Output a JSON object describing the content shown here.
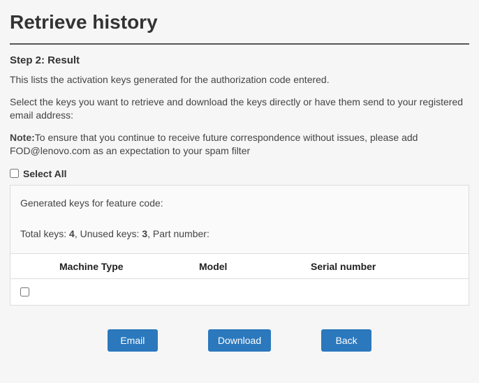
{
  "page": {
    "title": "Retrieve history",
    "step_title": "Step 2: Result",
    "desc1": "This lists the activation keys generated for the authorization code entered.",
    "desc2": "Select the keys you want to retrieve and download the keys directly or have them send to your registered email address:",
    "note_label": "Note:",
    "note_text": "To ensure that you continue to receive future correspondence without issues, please add FOD@lenovo.com as an expectation to your spam filter"
  },
  "select_all_label": "Select All",
  "info": {
    "generated_prefix": "Generated keys for feature code:",
    "total_keys_label": "Total keys: ",
    "total_keys_value": "4",
    "unused_keys_label": ", Unused keys: ",
    "unused_keys_value": "3",
    "part_number_label": ", Part number:"
  },
  "table": {
    "headers": {
      "machine_type": "Machine Type",
      "model": "Model",
      "serial_number": "Serial number"
    }
  },
  "buttons": {
    "email": "Email",
    "download": "Download",
    "back": "Back"
  }
}
